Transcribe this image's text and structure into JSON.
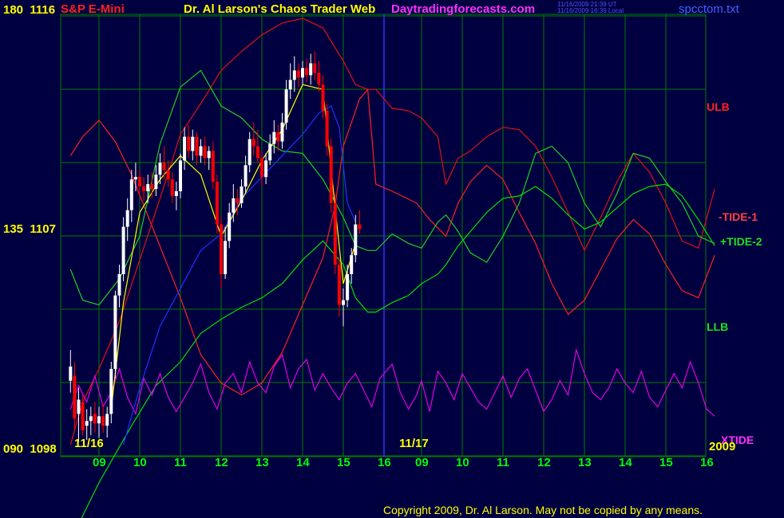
{
  "header": {
    "instrument": "S&P E-Mini",
    "title": "Dr. Al Larson's Chaos Trader Web",
    "site": "Daytradingforecasts.com",
    "stamp_ut": "11/16/2009 21:39 UT",
    "stamp_local": "11/16/2009 16:39 Local",
    "filename": "spcctom.txt"
  },
  "colors": {
    "background": "#000040",
    "grid": "#007a00",
    "price_up": "#ffffff",
    "price_down": "#ff0000",
    "ulb": "#ff2020",
    "llb": "#00e000",
    "tide_minus": "#e01010",
    "tide_plus": "#20d020",
    "xtide": "#e000e0",
    "moving_avg": "#2030ff",
    "smooth": "#ffff00",
    "divider": "#3030ff"
  },
  "axis": {
    "y_left": [
      {
        "label": "180",
        "price": "1116"
      },
      {
        "label": "135",
        "price": "1107"
      },
      {
        "label": "090",
        "price": "1098"
      }
    ],
    "x_ticks": [
      "09",
      "10",
      "11",
      "12",
      "13",
      "14",
      "15",
      "16",
      "09",
      "10",
      "11",
      "12",
      "13",
      "14",
      "15",
      "16"
    ],
    "dates": [
      "11/16",
      "11/17",
      "2009"
    ]
  },
  "legend": {
    "ulb": "ULB",
    "tide_minus": "-TIDE-1",
    "tide_plus": "+TIDE-2",
    "llb": "LLB",
    "xtide": "XTIDE"
  },
  "footer": {
    "copyright": "Copyright 2009, Dr. Al Larson. May not be copied by any means."
  },
  "chart_data": {
    "type": "line",
    "title": "S&P E-Mini",
    "y_range_price": [
      1098,
      1116
    ],
    "x_hours": [
      8.3,
      16.2,
      8.3,
      16.2
    ],
    "price_bars": [
      [
        8.3,
        1100.7,
        1102.0,
        1100.2,
        1101.3
      ],
      [
        8.4,
        1100.9,
        1101.5,
        1098.6,
        1099.1
      ],
      [
        8.5,
        1099.3,
        1100.4,
        1098.1,
        1099.9
      ],
      [
        8.6,
        1099.8,
        1100.1,
        1098.4,
        1098.6
      ],
      [
        8.7,
        1098.8,
        1099.5,
        1098.2,
        1099.0
      ],
      [
        8.8,
        1099.0,
        1099.6,
        1098.4,
        1099.2
      ],
      [
        8.9,
        1099.3,
        1099.8,
        1098.5,
        1098.9
      ],
      [
        9.0,
        1098.9,
        1099.6,
        1098.3,
        1099.2
      ],
      [
        9.1,
        1099.2,
        1099.7,
        1098.5,
        1098.8
      ],
      [
        9.2,
        1098.8,
        1099.6,
        1098.3,
        1099.3
      ],
      [
        9.3,
        1099.3,
        1101.5,
        1098.9,
        1101.2
      ],
      [
        9.4,
        1101.2,
        1104.5,
        1100.8,
        1104.3
      ],
      [
        9.5,
        1104.3,
        1105.6,
        1103.8,
        1105.2
      ],
      [
        9.6,
        1105.2,
        1107.6,
        1104.9,
        1107.2
      ],
      [
        9.7,
        1107.2,
        1108.4,
        1106.6,
        1107.9
      ],
      [
        9.8,
        1107.9,
        1109.6,
        1107.4,
        1109.2
      ],
      [
        9.9,
        1109.2,
        1109.9,
        1108.7,
        1109.3
      ],
      [
        10.0,
        1109.3,
        1109.6,
        1108.5,
        1108.9
      ],
      [
        10.1,
        1108.9,
        1109.3,
        1108.3,
        1108.7
      ],
      [
        10.2,
        1108.7,
        1109.4,
        1108.2,
        1109.0
      ],
      [
        10.3,
        1109.0,
        1109.5,
        1108.4,
        1108.8
      ],
      [
        10.4,
        1108.8,
        1109.8,
        1108.5,
        1109.4
      ],
      [
        10.5,
        1109.4,
        1110.3,
        1109.0,
        1109.9
      ],
      [
        10.6,
        1109.9,
        1110.6,
        1109.2,
        1109.6
      ],
      [
        10.7,
        1109.6,
        1110.0,
        1108.9,
        1109.2
      ],
      [
        10.8,
        1109.2,
        1109.5,
        1108.2,
        1108.5
      ],
      [
        10.9,
        1108.5,
        1109.1,
        1107.9,
        1108.7
      ],
      [
        11.0,
        1108.7,
        1110.3,
        1108.4,
        1110.0
      ],
      [
        11.1,
        1110.0,
        1111.4,
        1109.6,
        1111.0
      ],
      [
        11.2,
        1111.0,
        1111.5,
        1110.1,
        1110.4
      ],
      [
        11.3,
        1110.4,
        1111.3,
        1110.0,
        1111.0
      ],
      [
        11.4,
        1111.0,
        1111.2,
        1109.8,
        1110.2
      ],
      [
        11.5,
        1110.2,
        1110.9,
        1109.9,
        1110.6
      ],
      [
        11.6,
        1110.6,
        1111.0,
        1109.8,
        1110.1
      ],
      [
        11.7,
        1110.1,
        1110.6,
        1109.6,
        1110.4
      ],
      [
        11.8,
        1110.4,
        1110.8,
        1108.8,
        1109.1
      ],
      [
        11.9,
        1109.1,
        1109.4,
        1106.9,
        1107.3
      ],
      [
        12.0,
        1107.3,
        1107.6,
        1104.6,
        1105.2
      ],
      [
        12.1,
        1105.2,
        1107.2,
        1105.0,
        1106.6
      ],
      [
        12.2,
        1106.6,
        1108.2,
        1106.3,
        1107.8
      ],
      [
        12.3,
        1107.8,
        1109.0,
        1107.4,
        1108.4
      ],
      [
        12.4,
        1108.4,
        1108.8,
        1107.7,
        1108.2
      ],
      [
        12.5,
        1108.2,
        1109.2,
        1108.0,
        1108.9
      ],
      [
        12.6,
        1108.9,
        1110.2,
        1108.6,
        1109.8
      ],
      [
        12.7,
        1109.8,
        1111.2,
        1109.5,
        1110.9
      ],
      [
        12.8,
        1110.9,
        1111.6,
        1110.2,
        1110.6
      ],
      [
        12.9,
        1110.6,
        1111.3,
        1109.9,
        1110.1
      ],
      [
        13.0,
        1110.1,
        1110.4,
        1108.9,
        1109.3
      ],
      [
        13.1,
        1109.3,
        1110.3,
        1109.0,
        1110.0
      ],
      [
        13.2,
        1110.0,
        1111.1,
        1109.8,
        1110.7
      ],
      [
        13.3,
        1110.7,
        1111.7,
        1110.3,
        1111.2
      ],
      [
        13.4,
        1111.2,
        1111.5,
        1110.4,
        1110.8
      ],
      [
        13.5,
        1110.8,
        1112.0,
        1110.5,
        1111.6
      ],
      [
        13.6,
        1111.6,
        1113.4,
        1111.3,
        1113.0
      ],
      [
        13.7,
        1113.0,
        1114.1,
        1112.6,
        1113.4
      ],
      [
        13.8,
        1113.4,
        1114.4,
        1112.9,
        1113.8
      ],
      [
        13.9,
        1113.8,
        1114.1,
        1113.1,
        1113.5
      ],
      [
        14.0,
        1113.5,
        1114.2,
        1113.2,
        1113.9
      ],
      [
        14.1,
        1113.9,
        1114.3,
        1113.3,
        1113.6
      ],
      [
        14.2,
        1113.6,
        1114.5,
        1113.2,
        1114.1
      ],
      [
        14.3,
        1114.1,
        1114.6,
        1113.4,
        1113.7
      ],
      [
        14.4,
        1113.7,
        1114.2,
        1112.9,
        1113.2
      ],
      [
        14.5,
        1113.2,
        1113.6,
        1111.8,
        1112.1
      ],
      [
        14.6,
        1112.1,
        1112.4,
        1110.2,
        1110.6
      ],
      [
        14.7,
        1110.6,
        1110.9,
        1107.8,
        1108.2
      ],
      [
        14.8,
        1108.2,
        1108.6,
        1105.2,
        1105.6
      ],
      [
        14.9,
        1105.6,
        1105.9,
        1103.4,
        1103.9
      ],
      [
        15.0,
        1103.9,
        1104.6,
        1103.0,
        1104.1
      ],
      [
        15.1,
        1104.1,
        1105.6,
        1103.8,
        1105.2
      ],
      [
        15.2,
        1105.2,
        1106.3,
        1104.8,
        1106.0
      ],
      [
        15.3,
        1106.0,
        1107.7,
        1105.7,
        1107.3
      ],
      [
        15.4,
        1107.3,
        1107.9,
        1106.9,
        1107.1
      ]
    ],
    "series": [
      {
        "name": "ULB",
        "x": [
          8.3,
          8.6,
          9.0,
          9.4,
          9.8,
          10.4,
          11.0,
          11.5,
          12.0,
          12.5,
          13.0,
          13.5,
          14.0,
          14.5,
          14.8,
          15.0,
          15.4,
          15.6,
          15.8,
          16.2,
          16.8,
          17.2,
          17.6,
          17.9,
          18.2,
          18.6,
          19.0,
          19.4,
          19.8,
          20.2,
          20.6,
          21.0,
          21.4,
          21.8,
          22.2,
          22.6,
          23.0,
          23.4,
          23.8,
          24.2
        ],
        "values": [
          1110.2,
          1111.0,
          1111.7,
          1110.8,
          1109.4,
          1106.8,
          1104.2,
          1101.8,
          1100.6,
          1100.1,
          1100.6,
          1101.9,
          1103.9,
          1105.9,
          1108.1,
          1110.6,
          1112.6,
          1113.0,
          1109.0,
          1108.7,
          1108.2,
          1107.5,
          1106.8,
          1108.2,
          1109.1,
          1109.8,
          1109.2,
          1107.8,
          1106.5,
          1104.8,
          1103.5,
          1104.1,
          1105.4,
          1106.7,
          1107.5,
          1106.9,
          1105.6,
          1104.5,
          1104.2,
          1106.0
        ]
      },
      {
        "name": "-TIDE-1",
        "x": [
          8.3,
          8.6,
          9.0,
          9.5,
          10.0,
          10.5,
          11.0,
          11.5,
          12.0,
          12.5,
          13.0,
          13.5,
          14.0,
          14.5,
          15.0,
          15.3,
          15.6,
          15.8,
          16.2,
          16.6,
          17.0,
          17.4,
          17.6,
          17.9,
          18.2,
          18.6,
          19.0,
          19.4,
          19.8,
          20.2,
          20.6,
          21.0,
          21.4,
          21.8,
          22.2,
          22.6,
          23.0,
          23.4,
          23.8,
          24.2
        ],
        "values": [
          1098.0,
          1099.8,
          1101.2,
          1103.2,
          1105.8,
          1108.4,
          1111.1,
          1112.4,
          1113.8,
          1114.6,
          1115.3,
          1115.8,
          1116.0,
          1115.6,
          1114.2,
          1113.2,
          1113.0,
          1113.0,
          1112.2,
          1112.1,
          1111.8,
          1111.0,
          1109.0,
          1110.1,
          1110.4,
          1111.0,
          1111.4,
          1111.3,
          1110.6,
          1109.3,
          1107.8,
          1106.2,
          1107.6,
          1109.1,
          1110.3,
          1109.5,
          1108.2,
          1106.6,
          1106.3,
          1108.8
        ]
      },
      {
        "name": "+TIDE-2",
        "x": [
          8.3,
          8.6,
          9.0,
          9.5,
          10.0,
          10.5,
          11.0,
          11.5,
          12.0,
          12.5,
          13.0,
          13.5,
          14.0,
          14.5,
          15.0,
          15.3,
          15.6,
          15.8,
          16.2,
          16.6,
          17.0,
          17.4,
          17.6,
          17.9,
          18.2,
          18.6,
          19.0,
          19.4,
          19.8,
          20.2,
          20.6,
          21.0,
          21.4,
          21.8,
          22.2,
          22.6,
          23.0,
          23.4,
          23.8,
          24.2
        ],
        "values": [
          1105.4,
          1104.1,
          1103.9,
          1105.0,
          1106.8,
          1110.7,
          1113.1,
          1113.8,
          1112.3,
          1111.8,
          1110.9,
          1110.4,
          1110.3,
          1109.2,
          1107.6,
          1106.4,
          1106.2,
          1106.2,
          1106.9,
          1106.5,
          1106.3,
          1107.4,
          1107.7,
          1107.0,
          1106.1,
          1105.7,
          1106.8,
          1108.2,
          1110.3,
          1110.6,
          1109.9,
          1108.2,
          1107.2,
          1108.6,
          1110.3,
          1110.1,
          1109.1,
          1108.2,
          1106.8,
          1106.5
        ]
      },
      {
        "name": "LLB",
        "x": [
          8.3,
          8.6,
          9.0,
          9.4,
          9.8,
          10.4,
          11.0,
          11.5,
          12.0,
          12.5,
          13.0,
          13.5,
          14.0,
          14.5,
          15.0,
          15.3,
          15.6,
          15.8,
          16.2,
          16.6,
          17.0,
          17.4,
          17.6,
          17.9,
          18.2,
          18.6,
          19.0,
          19.4,
          19.8,
          20.2,
          20.6,
          21.0,
          21.4,
          21.8,
          22.2,
          22.6,
          23.0,
          23.4,
          23.8,
          24.2
        ],
        "values": [
          1094.0,
          1095.0,
          1096.4,
          1097.6,
          1098.8,
          1100.5,
          1101.5,
          1102.7,
          1103.3,
          1103.8,
          1104.2,
          1104.8,
          1105.8,
          1106.6,
          1105.6,
          1104.2,
          1103.6,
          1103.6,
          1104.0,
          1104.3,
          1104.8,
          1105.2,
          1105.6,
          1106.4,
          1107.0,
          1107.8,
          1108.4,
          1108.5,
          1108.9,
          1108.4,
          1107.7,
          1107.1,
          1107.4,
          1108.0,
          1108.6,
          1108.9,
          1109.0,
          1108.5,
          1107.5,
          1106.4
        ]
      },
      {
        "name": "XTIDE",
        "x": [
          8.3,
          8.5,
          8.7,
          8.9,
          9.1,
          9.3,
          9.5,
          9.7,
          9.9,
          10.1,
          10.3,
          10.5,
          10.7,
          10.9,
          11.1,
          11.3,
          11.5,
          11.7,
          11.9,
          12.1,
          12.3,
          12.5,
          12.7,
          12.9,
          13.1,
          13.3,
          13.5,
          13.7,
          13.9,
          14.1,
          14.3,
          14.5,
          14.7,
          14.9,
          15.1,
          15.3,
          15.5,
          15.7,
          15.9,
          16.2,
          16.4,
          16.6,
          16.8,
          17.0,
          17.2,
          17.4,
          17.6,
          17.8,
          18.0,
          18.2,
          18.4,
          18.6,
          18.8,
          19.0,
          19.2,
          19.4,
          19.6,
          19.8,
          20.0,
          20.2,
          20.4,
          20.6,
          20.8,
          21.0,
          21.2,
          21.4,
          21.6,
          21.8,
          22.0,
          22.2,
          22.4,
          22.6,
          22.8,
          23.0,
          23.2,
          23.4,
          23.6,
          23.8,
          24.0,
          24.2
        ],
        "values": [
          1099.5,
          1100.5,
          1099.8,
          1100.9,
          1099.6,
          1100.2,
          1101.2,
          1100.0,
          1099.3,
          1100.8,
          1100.1,
          1101.0,
          1100.0,
          1099.4,
          1100.0,
          1100.6,
          1101.4,
          1100.2,
          1099.5,
          1100.6,
          1101.0,
          1100.2,
          1101.5,
          1100.6,
          1100.2,
          1101.3,
          1101.8,
          1100.4,
          1101.2,
          1101.6,
          1100.3,
          1101.0,
          1100.4,
          1099.9,
          1100.6,
          1101.0,
          1100.3,
          1099.6,
          1100.8,
          1101.4,
          1100.2,
          1099.5,
          1100.1,
          1100.7,
          1099.4,
          1101.1,
          1100.6,
          1099.9,
          1101.0,
          1100.4,
          1099.8,
          1099.5,
          1100.2,
          1100.9,
          1100.0,
          1100.8,
          1101.2,
          1100.3,
          1099.4,
          1099.9,
          1100.7,
          1100.1,
          1102.0,
          1101.0,
          1100.2,
          1099.9,
          1100.4,
          1101.2,
          1100.6,
          1100.2,
          1101.1,
          1100.0,
          1099.6,
          1100.3,
          1101.0,
          1100.4,
          1101.5,
          1100.6,
          1099.5,
          1099.2
        ]
      },
      {
        "name": "",
        "x": [
          9.6,
          10.0,
          10.5,
          11.0,
          11.5,
          12.0,
          12.5,
          13.0,
          13.5,
          14.0,
          14.4,
          14.7,
          14.9,
          15.1,
          15.3
        ],
        "values": [
          1098.0,
          1100.4,
          1103.0,
          1104.6,
          1106.2,
          1106.9,
          1108.4,
          1109.3,
          1110.2,
          1111.1,
          1112.0,
          1112.3,
          1111.4,
          1108.2,
          1107.4
        ]
      },
      {
        "name": "",
        "x": [
          9.3,
          9.6,
          10.0,
          10.5,
          11.0,
          11.5,
          12.0,
          12.5,
          13.0,
          13.5,
          14.0,
          14.5,
          14.8,
          15.0,
          15.3
        ],
        "values": [
          1099.5,
          1104.0,
          1107.8,
          1109.2,
          1110.2,
          1109.4,
          1106.8,
          1108.3,
          1110.0,
          1111.3,
          1113.2,
          1113.0,
          1108.0,
          1104.8,
          1106.5
        ]
      }
    ]
  }
}
